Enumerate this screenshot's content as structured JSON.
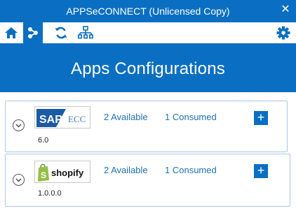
{
  "window": {
    "title": "APPSeCONNECT (Unlicensed Copy)",
    "close_glyph": "✕"
  },
  "toolbar": {
    "icons": [
      "home-icon",
      "connections-icon",
      "sync-icon",
      "hierarchy-icon",
      "settings-icon"
    ],
    "active": "connections-icon"
  },
  "banner": {
    "title": "Apps Configurations"
  },
  "apps": [
    {
      "name": "SAP ECC",
      "logo_text_primary": "SAP",
      "logo_text_secondary": "ECC",
      "version": "6.0",
      "available": "2 Available",
      "consumed": "1 Consumed",
      "add_glyph": "+"
    },
    {
      "name": "shopify",
      "logo_text_primary": "shopify",
      "version": "1.0.0.0",
      "available": "2 Available",
      "consumed": "1 Consumed",
      "add_glyph": "+"
    }
  ],
  "colors": {
    "accent": "#0a6fc2",
    "link": "#1f6fb5",
    "card_border": "#a9c8e8",
    "shopify_green": "#95bf47"
  }
}
